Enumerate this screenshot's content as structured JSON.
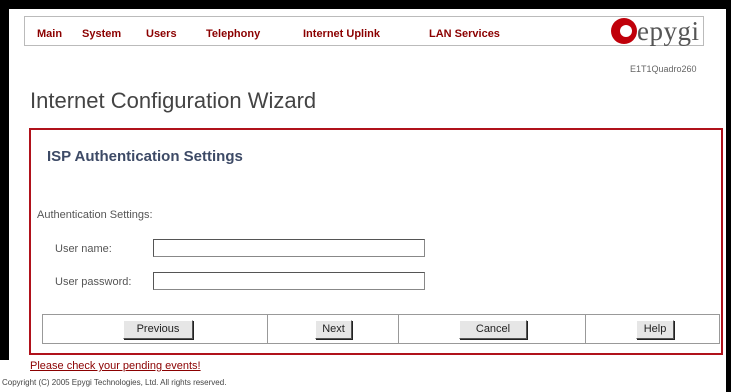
{
  "nav": {
    "main": "Main",
    "system": "System",
    "users": "Users",
    "telephony": "Telephony",
    "internet_uplink": "Internet Uplink",
    "lan_services": "LAN Services"
  },
  "logo": {
    "text": "epygi",
    "model": "E1T1Quadro260"
  },
  "page_title": "Internet Configuration Wizard",
  "panel": {
    "title": "ISP Authentication Settings",
    "section_label": "Authentication Settings:",
    "username_label": "User name:",
    "username_value": "",
    "password_label": "User password:",
    "password_value": ""
  },
  "buttons": {
    "previous": "Previous",
    "next": "Next",
    "cancel": "Cancel",
    "help": "Help"
  },
  "footer": {
    "pending": "Please check your pending events!",
    "copyright": "Copyright (C) 2005 Epygi Technologies, Ltd. All rights reserved."
  },
  "colors": {
    "accent": "#b0121b",
    "nav_text": "#8b0000",
    "panel_title": "#3d4a66"
  }
}
